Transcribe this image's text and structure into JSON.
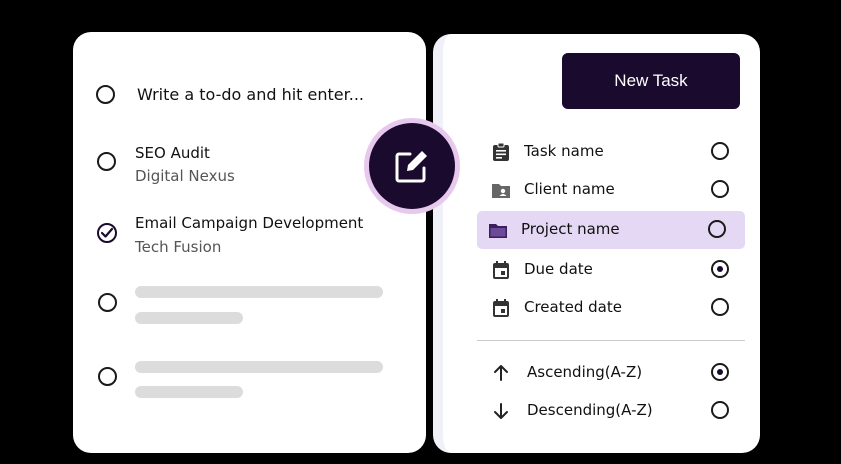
{
  "todo": {
    "input_placeholder": "Write a to-do and hit enter...",
    "tasks": [
      {
        "title": "SEO Audit",
        "client": "Digital Nexus",
        "done": false
      },
      {
        "title": "Email Campaign Development",
        "client": "Tech Fusion",
        "done": true
      }
    ]
  },
  "toolbar": {
    "new_task_label": "New Task"
  },
  "sort": {
    "fields": [
      {
        "label": "Task name",
        "icon": "clipboard-icon",
        "selected": false
      },
      {
        "label": "Client name",
        "icon": "folder-user-icon",
        "selected": false
      },
      {
        "label": "Project name",
        "icon": "folder-icon",
        "selected": false,
        "highlighted": true
      },
      {
        "label": "Due date",
        "icon": "calendar-icon",
        "selected": true
      },
      {
        "label": "Created date",
        "icon": "calendar-icon",
        "selected": false
      }
    ],
    "orders": [
      {
        "label": "Ascending(A-Z)",
        "icon": "arrow-up-icon",
        "selected": true
      },
      {
        "label": "Descending(A-Z)",
        "icon": "arrow-down-icon",
        "selected": false
      }
    ]
  },
  "colors": {
    "accent_dark": "#1a0a2e",
    "highlight": "#e4d8f5",
    "fab_ring": "#e8c9ee"
  }
}
